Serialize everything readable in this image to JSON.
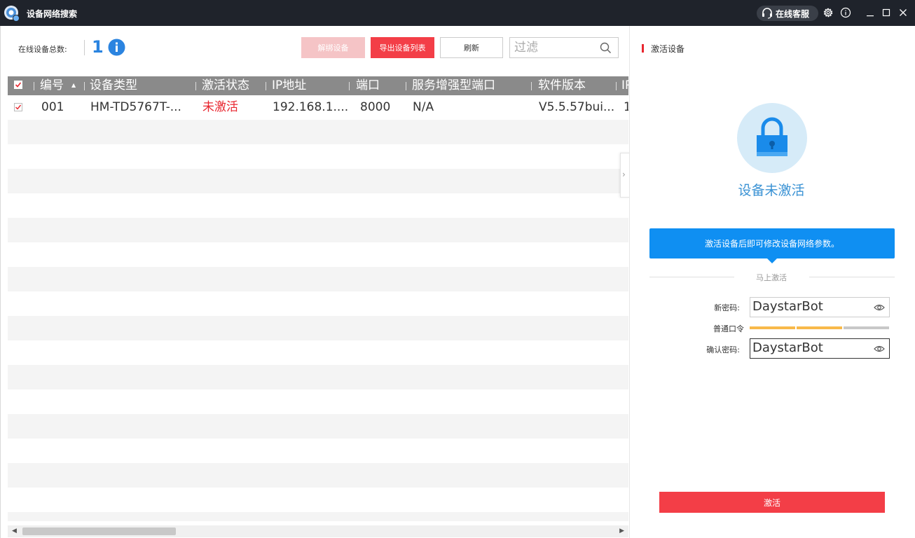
{
  "window": {
    "title": "设备网络搜索",
    "support_label": "在线客服",
    "icons": [
      "app-logo-icon",
      "headset-icon",
      "gear-icon",
      "info-icon",
      "minimize-icon",
      "maximize-icon",
      "close-icon"
    ]
  },
  "toolbar": {
    "online_count_label": "在线设备总数:",
    "online_count": "1",
    "unbind_label": "解绑设备",
    "export_label": "导出设备列表",
    "refresh_label": "刷新",
    "filter_placeholder": "过滤"
  },
  "table": {
    "columns": [
      "编号",
      "设备类型",
      "激活状态",
      "IP地址",
      "端口",
      "服务增强型端口",
      "软件版本",
      "IP"
    ],
    "rows": [
      {
        "checked": true,
        "no": "001",
        "device_type": "HM-TD5767T-...",
        "status": "未激活",
        "ip": "192.168.1....",
        "port": "8000",
        "enhanced_port": "N/A",
        "software_version": "V5.5.57bui...",
        "extra": "1"
      }
    ]
  },
  "colors": {
    "accent_red": "#f33e47",
    "accent_blue": "#0f8ff2",
    "title_bar": "#1f232b",
    "header_gray": "#8a8a8a",
    "inactive_text": "#3a92d4",
    "strength_orange": "#f8b94a",
    "strength_gray": "#c8c8c8"
  },
  "activation": {
    "panel_title": "激活设备",
    "status_text": "设备未激活",
    "tip": "激活设备后即可修改设备网络参数。",
    "section_label": "马上激活",
    "new_password_label": "新密码:",
    "new_password_value": "DaystarBot",
    "strength_label": "普通口令",
    "strength_level": "2/3",
    "confirm_password_label": "确认密码:",
    "confirm_password_value": "DaystarBot",
    "activate_button": "激活"
  }
}
